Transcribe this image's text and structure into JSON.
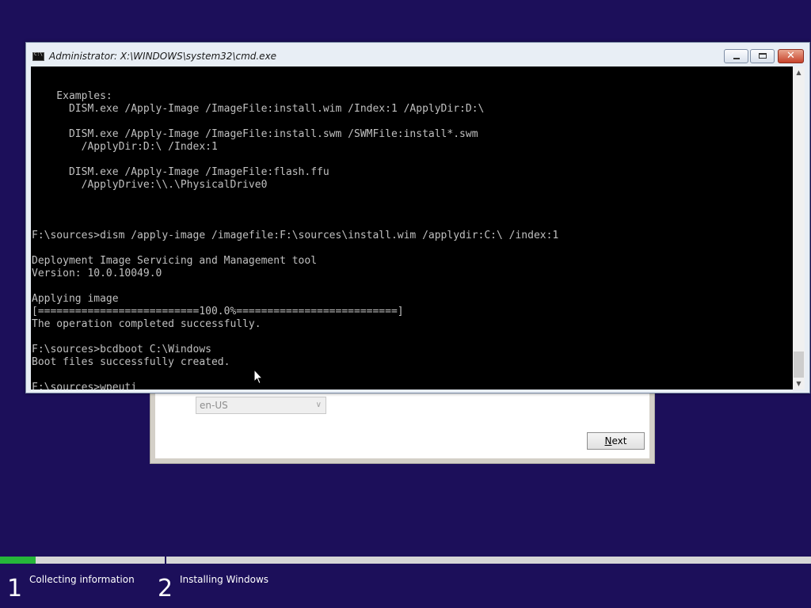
{
  "colors": {
    "desktop": "#1c0f5a",
    "console_bg": "#000000",
    "console_fg": "#c0c0c0",
    "progress_fill": "#26b63a"
  },
  "setup_dialog": {
    "locale_value": "en-US",
    "next_button": {
      "first_char": "N",
      "rest": "ext"
    }
  },
  "cmd_window": {
    "title": "Administrator: X:\\WINDOWS\\system32\\cmd.exe",
    "buttons": {
      "minimize": "minimize-icon",
      "maximize": "maximize-icon",
      "close": "close-icon"
    },
    "lines": [
      "",
      "    Examples:",
      "      DISM.exe /Apply-Image /ImageFile:install.wim /Index:1 /ApplyDir:D:\\",
      "",
      "      DISM.exe /Apply-Image /ImageFile:install.swm /SWMFile:install*.swm",
      "        /ApplyDir:D:\\ /Index:1",
      "",
      "      DISM.exe /Apply-Image /ImageFile:flash.ffu",
      "        /ApplyDrive:\\\\.\\PhysicalDrive0",
      "",
      "",
      "",
      "F:\\sources>dism /apply-image /imagefile:F:\\sources\\install.wim /applydir:C:\\ /index:1",
      "",
      "Deployment Image Servicing and Management tool",
      "Version: 10.0.10049.0",
      "",
      "Applying image",
      "[==========================100.0%==========================]",
      "The operation completed successfully.",
      "",
      "F:\\sources>bcdboot C:\\Windows",
      "Boot files successfully created.",
      ""
    ],
    "prompt_line": "F:\\sources>wpeuti"
  },
  "progress": {
    "fill_fraction": 0.044,
    "steps": [
      {
        "number": "1",
        "label": "Collecting information"
      },
      {
        "number": "2",
        "label": "Installing Windows"
      }
    ]
  }
}
